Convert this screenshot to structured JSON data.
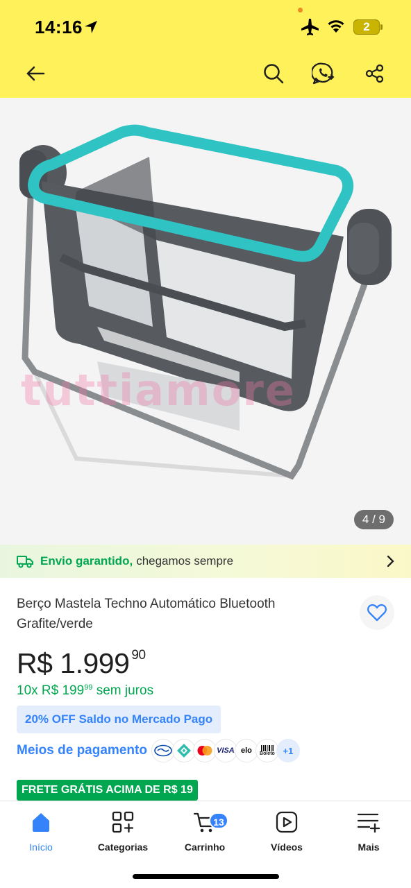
{
  "status": {
    "time": "14:16",
    "battery": "2"
  },
  "gallery": {
    "counter": "4 / 9",
    "watermark": "tuttiamore"
  },
  "shipping": {
    "strong": "Envio garantido,",
    "text": "chegamos sempre"
  },
  "product": {
    "title": "Berço Mastela Techno Automático Bluetooth Grafite/verde",
    "price_int": "R$ 1.999",
    "price_cents": "90",
    "installments_prefix": "10x R$ 199",
    "installments_cents": "99",
    "installments_suffix": "sem juros",
    "discount": "20% OFF Saldo no Mercado Pago",
    "payment_link": "Meios de pagamento",
    "payment_more": "+1",
    "free_shipping": "FRETE GRÁTIS ACIMA DE R$ 19"
  },
  "payment_methods": [
    "mercado-pago",
    "pix",
    "mastercard",
    "visa",
    "elo",
    "boleto"
  ],
  "payment_labels": {
    "visa": "VISA",
    "elo": "elo",
    "boleto": "Boleto"
  },
  "nav": {
    "items": [
      {
        "label": "Início",
        "icon": "home-icon",
        "active": true
      },
      {
        "label": "Categorias",
        "icon": "categories-icon"
      },
      {
        "label": "Carrinho",
        "icon": "cart-icon",
        "badge": "13"
      },
      {
        "label": "Vídeos",
        "icon": "video-icon"
      },
      {
        "label": "Mais",
        "icon": "more-icon"
      }
    ]
  },
  "colors": {
    "header": "#fff159",
    "accent": "#3483fa",
    "green": "#00a650"
  }
}
